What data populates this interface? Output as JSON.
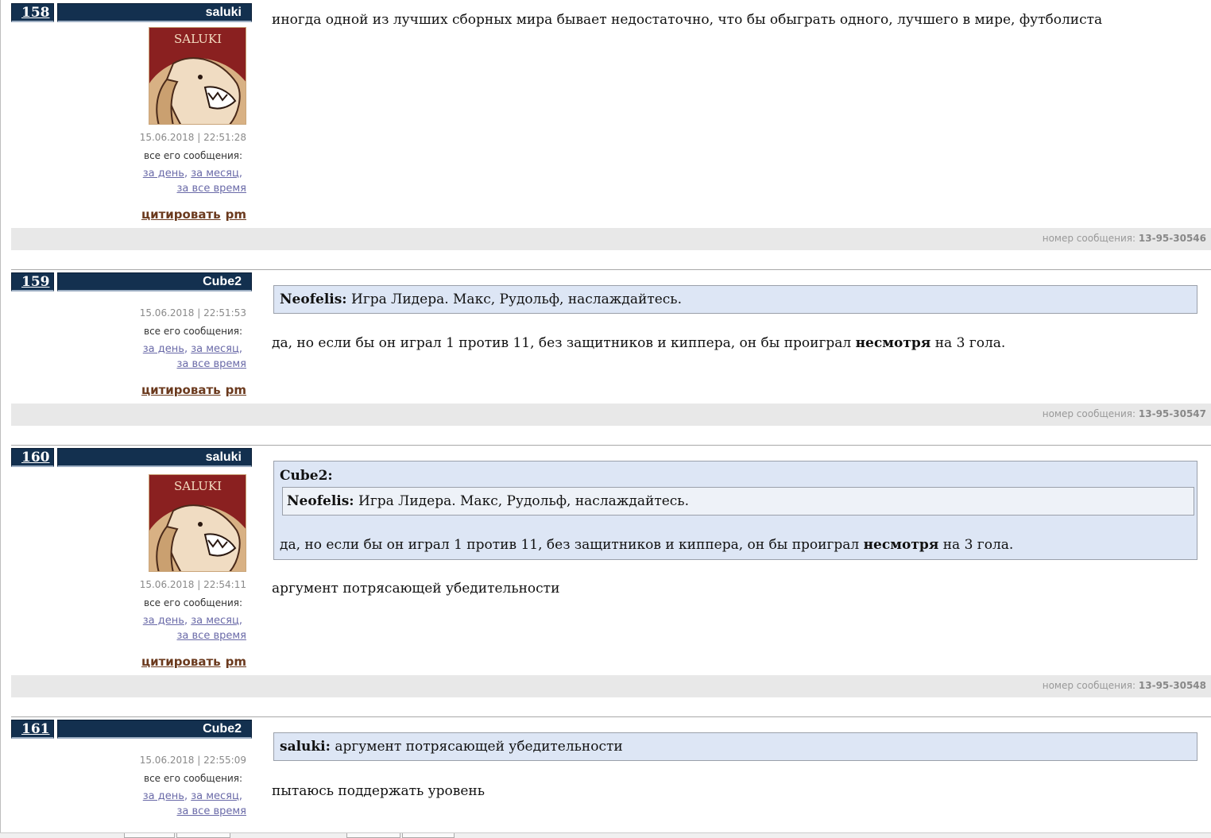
{
  "labels": {
    "all_messages": "все его сообщения:",
    "per_day": "за день",
    "per_month": "за месяц",
    "all_time": "за все время",
    "quote_action": "цитировать",
    "pm_action": "pm",
    "message_number_label": "номер сообщения:",
    "comma": ","
  },
  "avatar_text": "SALUKI",
  "posts": [
    {
      "num": "158",
      "author": "saluki",
      "date": "15.06.2018 | 22:51:28",
      "text": "иногда одной из лучших сборных мира бывает недостаточно, что бы обыграть одного, лучшего в мире, футболиста",
      "msg_id": "13-95-30546"
    },
    {
      "num": "159",
      "author": "Cube2",
      "date": "15.06.2018 | 22:51:53",
      "quote_author": "Neofelis:",
      "quote_text": "Игра Лидера. Макс, Рудольф, наслаждайтесь.",
      "text_before": "да, но если бы он играл 1 против 11, без защитников и киппера, он бы проиграл",
      "text_bold": "несмотря",
      "text_after": "на 3 гола.",
      "msg_id": "13-95-30547"
    },
    {
      "num": "160",
      "author": "saluki",
      "date": "15.06.2018 | 22:54:11",
      "quote_author": "Cube2:",
      "inner_quote_author": "Neofelis:",
      "inner_quote_text": "Игра Лидера. Макс, Рудольф, наслаждайтесь.",
      "quote_text_before": "да, но если бы он играл 1 против 11, без защитников и киппера, он бы проиграл",
      "quote_text_bold": "несмотря",
      "quote_text_after": "на 3 гола.",
      "text": "аргумент потрясающей убедительности",
      "msg_id": "13-95-30548"
    },
    {
      "num": "161",
      "author": "Cube2",
      "date": "15.06.2018 | 22:55:09",
      "quote_author": "saluki:",
      "quote_text": "аргумент потрясающей убедительности",
      "text": "пытаюсь поддержать уровень"
    }
  ]
}
